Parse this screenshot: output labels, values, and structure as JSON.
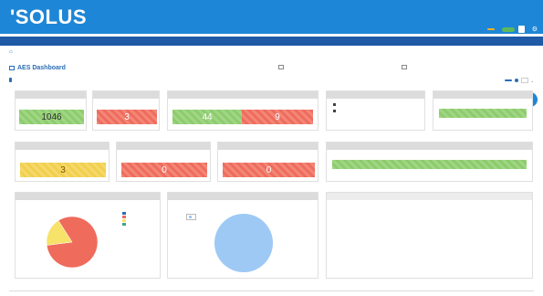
{
  "header": {
    "logo": "'SOLUS",
    "badge": "",
    "user_label": "",
    "user_name": ""
  },
  "menu": {
    "items": [
      "",
      "",
      "",
      "",
      "",
      ""
    ],
    "right": ""
  },
  "breadcrumb": {
    "items": [
      "",
      ""
    ]
  },
  "page": {
    "title": "AES Dashboard",
    "toolbar_link_1": "",
    "toolbar_link_2": "",
    "sub_link": "",
    "button_label": "",
    "select_value": ""
  },
  "panels": {
    "p1": {
      "title": "",
      "value": "1046"
    },
    "p2": {
      "title": "",
      "value": "3"
    },
    "p3": {
      "title": "",
      "value_left": "44",
      "value_right": "9"
    },
    "p4": {
      "title": "",
      "rows": [
        {
          "label": "",
          "value": ""
        },
        {
          "label": "",
          "value": ""
        }
      ]
    },
    "p5": {
      "title": "",
      "status": ""
    },
    "p6": {
      "title": "",
      "value": "3"
    },
    "p7": {
      "title": "",
      "value": "0"
    },
    "p8": {
      "title": "",
      "value": "0"
    },
    "p9": {
      "title": "",
      "status": ""
    },
    "p10": {
      "title": "",
      "legend": [
        "",
        "",
        "",
        ""
      ]
    },
    "p11": {
      "title": "",
      "tooltip": "",
      "zoom_a": "",
      "zoom_b": ""
    },
    "p12": {
      "note": ""
    }
  },
  "colors": {
    "header": "#1e86d6",
    "menubar": "#1f5aa6",
    "green": "#8ccc6b",
    "red": "#ef6b5b",
    "yellow": "#f2cf4a",
    "pie_red": "#ef6b5b",
    "pie_yellow": "#f7e26a",
    "pie_blue": "#9ec9f5"
  },
  "chart_data": {
    "type": "pie",
    "title": "",
    "slices": [
      {
        "name": "",
        "value": 82,
        "color": "#ef6b5b"
      },
      {
        "name": "",
        "value": 18,
        "color": "#f7e26a"
      }
    ]
  }
}
